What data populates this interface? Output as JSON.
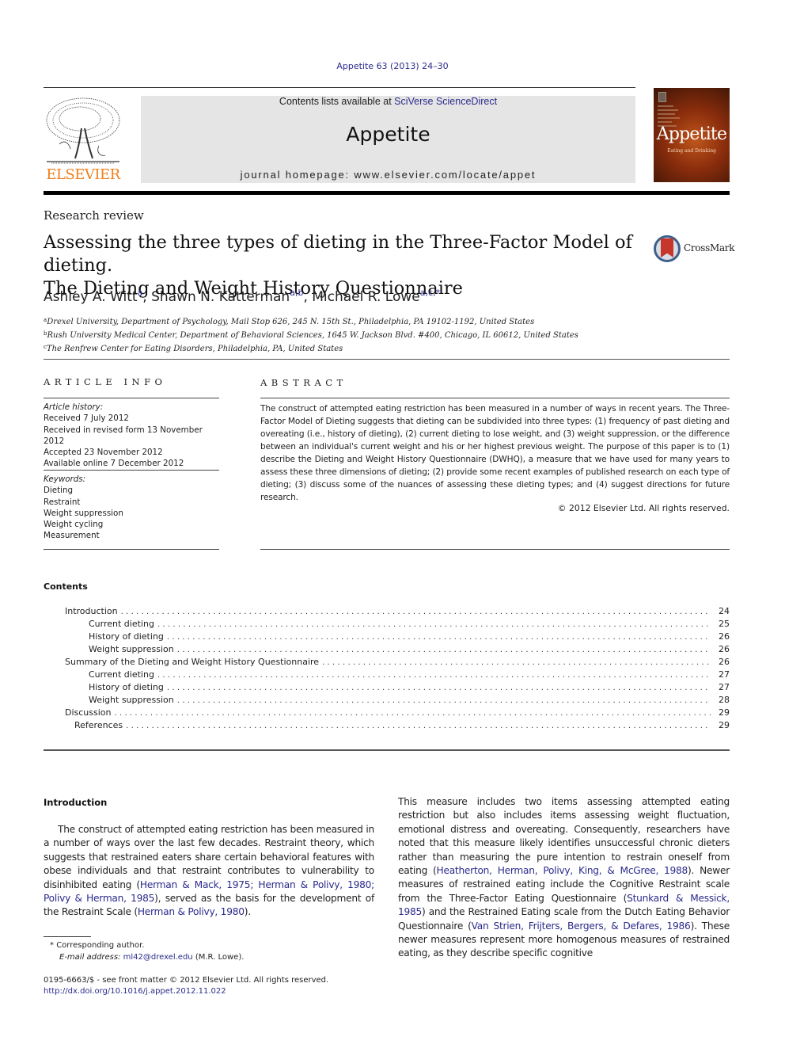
{
  "header": {
    "journal_ref": "Appetite 63 (2013) 24–30",
    "contents_prefix": "Contents lists available at ",
    "contents_link": "SciVerse ScienceDirect",
    "journal_name": "Appetite",
    "homepage": "journal homepage: www.elsevier.com/locate/appet",
    "publisher": "ELSEVIER",
    "cover_title": "Appetite",
    "cover_subtitle": "Eating and Drinking"
  },
  "article": {
    "type": "Research review",
    "title_line1": "Assessing the three types of dieting in the Three-Factor Model of dieting.",
    "title_line2": "The Dieting and Weight History Questionnaire",
    "crossmark_label": "CrossMark",
    "authors": [
      {
        "name": "Ashley A. Witt",
        "sup": "a",
        "sep": ", "
      },
      {
        "name": "Shawn N. Katterman",
        "sup": "a,b",
        "sep": ", "
      },
      {
        "name": "Michael R. Lowe",
        "sup": "a,c,*",
        "sep": ""
      }
    ],
    "affiliations": [
      {
        "key": "a",
        "text": "Drexel University, Department of Psychology, Mail Stop 626, 245 N. 15th St., Philadelphia, PA 19102-1192, United States"
      },
      {
        "key": "b",
        "text": "Rush University Medical Center, Department of Behavioral Sciences, 1645 W. Jackson Blvd. #400, Chicago, IL 60612, United States"
      },
      {
        "key": "c",
        "text": "The Renfrew Center for Eating Disorders, Philadelphia, PA, United States"
      }
    ]
  },
  "article_info": {
    "heading": "ARTICLE INFO",
    "history_label": "Article history:",
    "history": [
      "Received 7 July 2012",
      "Received in revised form 13 November 2012",
      "Accepted 23 November 2012",
      "Available online 7 December 2012"
    ],
    "keywords_label": "Keywords:",
    "keywords": [
      "Dieting",
      "Restraint",
      "Weight suppression",
      "Weight cycling",
      "Measurement"
    ]
  },
  "abstract": {
    "heading": "ABSTRACT",
    "text": "The construct of attempted eating restriction has been measured in a number of ways in recent years. The Three-Factor Model of Dieting suggests that dieting can be subdivided into three types: (1) frequency of past dieting and overeating (i.e., history of dieting), (2) current dieting to lose weight, and (3) weight suppression, or the difference between an individual's current weight and his or her highest previous weight. The purpose of this paper is to (1) describe the Dieting and Weight History Questionnaire (DWHQ), a measure that we have used for many years to assess these three dimensions of dieting; (2) provide some recent examples of published research on each type of dieting; (3) discuss some of the nuances of assessing these dieting types; and (4) suggest directions for future research.",
    "copyright": "© 2012 Elsevier Ltd. All rights reserved."
  },
  "contents": {
    "heading": "Contents",
    "items": [
      {
        "label": "Introduction",
        "page": "24",
        "level": 0
      },
      {
        "label": "Current dieting",
        "page": "25",
        "level": 1
      },
      {
        "label": "History of dieting",
        "page": "26",
        "level": 1
      },
      {
        "label": "Weight suppression",
        "page": "26",
        "level": 1
      },
      {
        "label": "Summary of the Dieting and Weight History Questionnaire",
        "page": "26",
        "level": 0
      },
      {
        "label": "Current dieting",
        "page": "27",
        "level": 1
      },
      {
        "label": "History of dieting",
        "page": "27",
        "level": 1
      },
      {
        "label": "Weight suppression",
        "page": "28",
        "level": 1
      },
      {
        "label": "Discussion",
        "page": "29",
        "level": 0
      },
      {
        "label": "References",
        "page": "29",
        "level": 2
      }
    ]
  },
  "introduction": {
    "heading": "Introduction",
    "col1": [
      {
        "t": "The construct of attempted eating restriction has been measured in a number of ways over the last few decades. Restraint theory, which suggests that restrained eaters share certain behavioral features with obese individuals and that restraint contributes to vulnerability to disinhibited eating (",
        "link": false
      },
      {
        "t": "Herman & Mack, 1975; Herman & Polivy, 1980; Polivy & Herman, 1985",
        "link": true
      },
      {
        "t": "), served as the basis for the development of the Restraint Scale (",
        "link": false
      },
      {
        "t": "Herman & Polivy, 1980",
        "link": true
      },
      {
        "t": ").",
        "link": false
      }
    ],
    "col2": [
      {
        "t": "This measure includes two items assessing attempted eating restriction but also includes items assessing weight fluctuation, emotional distress and overeating. Consequently, researchers have noted that this measure likely identifies unsuccessful chronic dieters rather than measuring the pure intention to restrain oneself from eating (",
        "link": false
      },
      {
        "t": "Heatherton, Herman, Polivy, King, & McGree, 1988",
        "link": true
      },
      {
        "t": "). Newer measures of restrained eating include the Cognitive Restraint scale from the Three-Factor Eating Questionnaire (",
        "link": false
      },
      {
        "t": "Stunkard & Messick, 1985",
        "link": true
      },
      {
        "t": ") and the Restrained Eating scale from the Dutch Eating Behavior Questionnaire (",
        "link": false
      },
      {
        "t": "Van Strien, Frijters, Bergers, & Defares, 1986",
        "link": true
      },
      {
        "t": "). These newer measures represent more homogenous measures of restrained eating, as they describe specific cognitive",
        "link": false
      }
    ]
  },
  "footnote": {
    "mark": "*",
    "corresponding": "Corresponding author.",
    "email_label": "E-mail address:",
    "email": "ml42@drexel.edu",
    "email_suffix": " (M.R. Lowe).",
    "issn_line": "0195-6663/$ - see front matter © 2012 Elsevier Ltd. All rights reserved.",
    "doi": "http://dx.doi.org/10.1016/j.appet.2012.11.022"
  },
  "colors": {
    "link": "#2b2b8c",
    "elsevier_orange": "#f07f1b",
    "masthead_bg": "#e5e5e5",
    "crossmark_red": "#c7362a"
  }
}
